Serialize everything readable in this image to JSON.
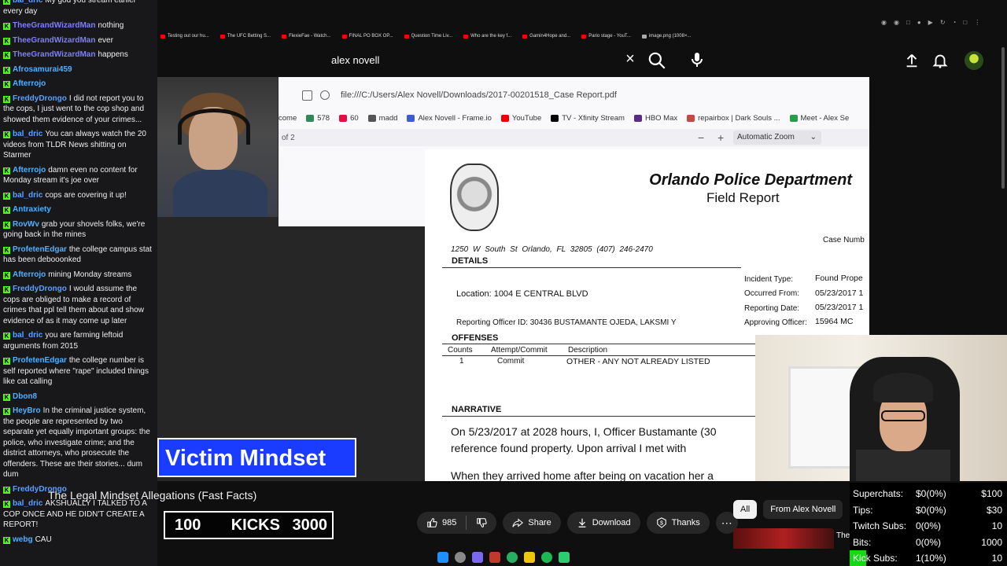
{
  "chat": {
    "messages": [
      {
        "user": "bal_dric",
        "color": "#5aa0ff",
        "text": "My god you stream earlier every day"
      },
      {
        "user": "TheeGrandWizardMan",
        "color": "#7e7eff",
        "text": "nothing"
      },
      {
        "user": "TheeGrandWizardMan",
        "color": "#7e7eff",
        "text": "ever"
      },
      {
        "user": "TheeGrandWizardMan",
        "color": "#7e7eff",
        "text": "happens"
      },
      {
        "user": "Afrosamurai459",
        "color": "#4fb0ff",
        "text": ""
      },
      {
        "user": "Afterrojo",
        "color": "#4fb0ff",
        "text": ""
      },
      {
        "user": "FreddyDrongo",
        "color": "#5aa0ff",
        "text": "I did not report you to the cops, I just went to the cop shop and showed them evidence of your crimes..."
      },
      {
        "user": "bal_dric",
        "color": "#5aa0ff",
        "text": "You can always watch the 20 videos from TLDR News shitting on Starmer"
      },
      {
        "user": "Afterrojo",
        "color": "#4fb0ff",
        "text": "damn even no content for Monday stream it's joe over"
      },
      {
        "user": "bal_dric",
        "color": "#5aa0ff",
        "text": "cops are covering it up!"
      },
      {
        "user": "Antraxiety",
        "color": "#4fb0ff",
        "text": ""
      },
      {
        "user": "RovWv",
        "color": "#4fb0ff",
        "text": "grab your shovels folks, we're going back in the mines"
      },
      {
        "user": "ProfetenEdgar",
        "color": "#4fb0ff",
        "text": "the college campus stat has been debooonked"
      },
      {
        "user": "Afterrojo",
        "color": "#4fb0ff",
        "text": "mining Monday streams"
      },
      {
        "user": "FreddyDrongo",
        "color": "#5aa0ff",
        "text": "I would assume the cops are obliged to make a record of crimes that ppl tell them about and show evidence of as it may come up later"
      },
      {
        "user": "bal_dric",
        "color": "#5aa0ff",
        "text": "you are farming leftoid arguments from 2015"
      },
      {
        "user": "ProfetenEdgar",
        "color": "#4fb0ff",
        "text": "the college number is self reported where \"rape\" included things like cat calling"
      },
      {
        "user": "Dbon8",
        "color": "#4fb0ff",
        "text": ""
      },
      {
        "user": "HeyBro",
        "color": "#4fb0ff",
        "text": "In the criminal justice system, the people are represented by two separate yet equally important groups: the police, who investigate crime; and the district attorneys, who prosecute the offenders. These are their stories... dum dum"
      },
      {
        "user": "FreddyDrongo",
        "color": "#5aa0ff",
        "text": ""
      },
      {
        "user": "bal_dric",
        "color": "#5aa0ff",
        "text": "AKSHUALLY I TALKED TO A COP ONCE AND HE DIDN'T CREATE A REPORT!"
      }
    ],
    "bottom_user": "webg",
    "bottom_text": "CAU"
  },
  "browser_tabs": [
    "Testing out our hu...",
    "The UFC Betting S...",
    "FlexieFae - Watch...",
    "FINAL PO BOX OP...",
    "Question Time Liv...",
    "Who are the key f...",
    "Gamin4Hope and...",
    "Pario stage - YouT...",
    "image.png (1008×..."
  ],
  "search": {
    "query": "alex novell"
  },
  "pdf": {
    "url": "file:///C:/Users/Alex Novell/Downloads/2017-00201518_Case Report.pdf",
    "bookmarks": [
      "come",
      "578",
      "60",
      "madd",
      "Alex Novell - Frame.io",
      "YouTube",
      "TV - Xfinity Stream",
      "HBO Max",
      "repairbox | Dark Souls ...",
      "Meet - Alex Se"
    ],
    "page_of": "of 2",
    "zoom": "Automatic Zoom",
    "department": "Orlando Police Department",
    "report_type": "Field Report",
    "case_number_label": "Case Numb",
    "address": "1250  W South St   Orlando, FL   32805     (407) 246-2470",
    "details_header": "DETAILS",
    "location": "Location: 1004 E CENTRAL BLVD",
    "reporting_officer": "Reporting Officer ID:  30436      BUSTAMANTE OJEDA, LAKSMI Y",
    "incident_type_label": "Incident Type:",
    "incident_type_value": "Found Prope",
    "occurred_from_label": "Occurred From:",
    "occurred_from_value": "05/23/2017  1",
    "reporting_date_label": "Reporting Date:",
    "reporting_date_value": "05/23/2017  1",
    "approving_officer_label": "Approving Officer:",
    "approving_officer_value": "15964  MC",
    "offenses_header": "OFFENSES",
    "col_counts": "Counts",
    "col_attempt": "Attempt/Commit",
    "col_description": "Description",
    "offense_count": "1",
    "offense_attempt": "Commit",
    "offense_description": "OTHER - ANY NOT ALREADY LISTED",
    "narrative_header": "NARRATIVE",
    "narrative_1": "On 5/23/2017 at 2028 hours, I, Officer Bustamante (30",
    "narrative_2": "reference found property.  Upon arrival I met with",
    "narrative_3": "When they arrived home after being on vacation her a"
  },
  "lower_third": "Victim Mindset",
  "video_title": "The Legal Mindset Allegations (Fast Facts)",
  "kicks": {
    "left": "100",
    "label": "KICKS",
    "goal": "3000"
  },
  "actions": {
    "likes": "985",
    "share": "Share",
    "download": "Download",
    "thanks": "Thanks"
  },
  "chips": [
    "All",
    "From Alex Novell"
  ],
  "related_title": "The",
  "stats": [
    {
      "label": "Superchats:",
      "value": "$0(0%)",
      "goal": "$100"
    },
    {
      "label": "Tips:",
      "value": "$0(0%)",
      "goal": "$30"
    },
    {
      "label": "Twitch Subs:",
      "value": "0(0%)",
      "goal": "10"
    },
    {
      "label": "Bits:",
      "value": "0(0%)",
      "goal": "1000"
    },
    {
      "label": "Kick Subs:",
      "value": "1(10%)",
      "goal": "10"
    }
  ],
  "kick_subs_progress": 0.1,
  "colors": {
    "kick_green": "#53fc18",
    "lower_third_blue": "#1a3cff"
  }
}
